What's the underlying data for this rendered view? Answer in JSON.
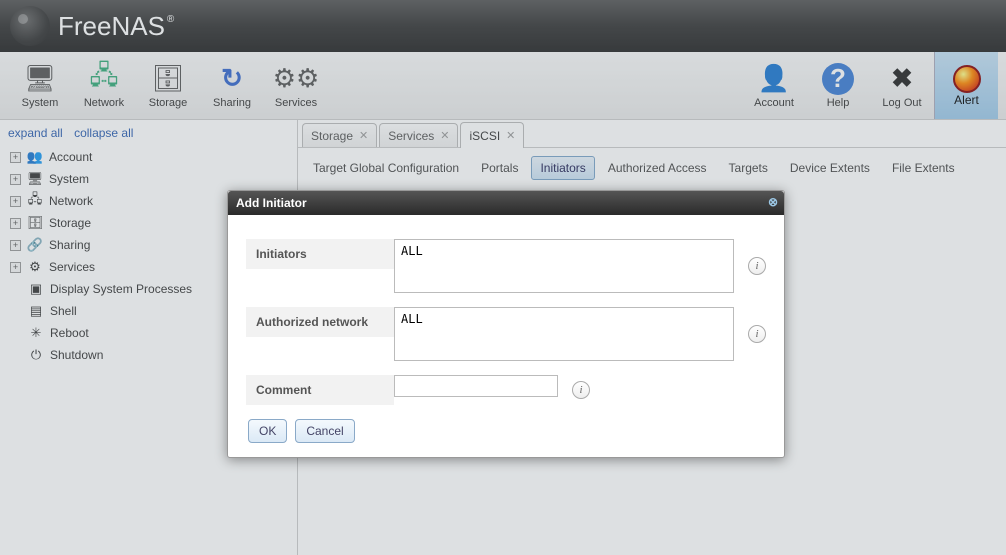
{
  "brand": {
    "name": "FreeNAS",
    "tm": "®"
  },
  "toolbar": {
    "left": [
      {
        "label": "System",
        "icon": "system-icon"
      },
      {
        "label": "Network",
        "icon": "network-icon"
      },
      {
        "label": "Storage",
        "icon": "storage-icon"
      },
      {
        "label": "Sharing",
        "icon": "sharing-icon"
      },
      {
        "label": "Services",
        "icon": "services-icon"
      }
    ],
    "right": [
      {
        "label": "Account",
        "icon": "account-icon"
      },
      {
        "label": "Help",
        "icon": "help-icon"
      },
      {
        "label": "Log Out",
        "icon": "logout-icon"
      }
    ],
    "alert": {
      "label": "Alert",
      "icon": "alert-icon"
    }
  },
  "sidebar": {
    "expand_all": "expand all",
    "collapse_all": "collapse all",
    "items": [
      {
        "label": "Account",
        "icon": "👥",
        "expandable": true
      },
      {
        "label": "System",
        "icon": "🖥",
        "expandable": true
      },
      {
        "label": "Network",
        "icon": "🖧",
        "expandable": true
      },
      {
        "label": "Storage",
        "icon": "🗄",
        "expandable": true
      },
      {
        "label": "Sharing",
        "icon": "🔗",
        "expandable": true
      },
      {
        "label": "Services",
        "icon": "⚙",
        "expandable": true
      }
    ],
    "sub": [
      {
        "label": "Display System Processes",
        "icon": "▣"
      },
      {
        "label": "Shell",
        "icon": "▤"
      },
      {
        "label": "Reboot",
        "icon": "✳"
      },
      {
        "label": "Shutdown",
        "icon": "⏻"
      }
    ]
  },
  "tabs": {
    "items": [
      {
        "label": "Storage",
        "closable": true,
        "active": false
      },
      {
        "label": "Services",
        "closable": true,
        "active": false
      },
      {
        "label": "iSCSI",
        "closable": true,
        "active": true
      }
    ]
  },
  "iscsi_nav": {
    "items": [
      {
        "label": "Target Global Configuration",
        "active": false
      },
      {
        "label": "Portals",
        "active": false
      },
      {
        "label": "Initiators",
        "active": true
      },
      {
        "label": "Authorized Access",
        "active": false
      },
      {
        "label": "Targets",
        "active": false
      },
      {
        "label": "Device Extents",
        "active": false
      },
      {
        "label": "File Extents",
        "active": false
      }
    ]
  },
  "dialog": {
    "title": "Add Initiator",
    "fields": {
      "initiators": {
        "label": "Initiators",
        "value": "ALL"
      },
      "authorized_network": {
        "label": "Authorized network",
        "value": "ALL"
      },
      "comment": {
        "label": "Comment",
        "value": ""
      }
    },
    "buttons": {
      "ok": "OK",
      "cancel": "Cancel"
    }
  }
}
